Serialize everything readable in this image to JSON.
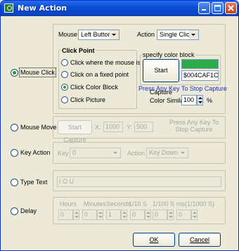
{
  "window": {
    "title": "New Action"
  },
  "mouse_click": {
    "label": "Mouse Click",
    "mouse_label": "Mouse",
    "mouse_value": "Left Button",
    "action_label": "Action",
    "action_value": "Single Click",
    "click_point": {
      "title": "Click Point",
      "options": [
        "Click where the mouse is",
        "Click on a fixed point",
        "Click Color Block",
        "Click Picture"
      ],
      "selected": 2
    },
    "color_block": {
      "title": "specify color block",
      "capture_button": "Start Capture",
      "color_hex": "$004CAF1C",
      "swatch_color": "#2daa4a",
      "hint": "Press Any Key To Stop Capture",
      "similar_label": "Color Similar:",
      "similar_value": "100",
      "similar_unit": "%"
    }
  },
  "mouse_move": {
    "label": "Mouse Move",
    "capture_button": "Start Capture",
    "x_label": "X:",
    "x_value": "1000",
    "y_label": "Y:",
    "y_value": "500",
    "hint": "Press Any Key To Stop Capture"
  },
  "key_action": {
    "label": "Key Action",
    "key_label": "Key",
    "key_value": "0",
    "action_label": "Action",
    "action_value": "Key Down"
  },
  "type_text": {
    "label": "Type Text",
    "value": "I O U"
  },
  "delay": {
    "label": "Delay",
    "headers": [
      "Hours",
      "Minutes",
      "Seconds",
      "1/10 S",
      "1/100 S",
      "ms(1/1000 S)"
    ],
    "values": [
      "0",
      "0",
      "1",
      "0",
      "0",
      "0"
    ]
  },
  "buttons": {
    "ok": "OK",
    "cancel": "Cancel"
  }
}
